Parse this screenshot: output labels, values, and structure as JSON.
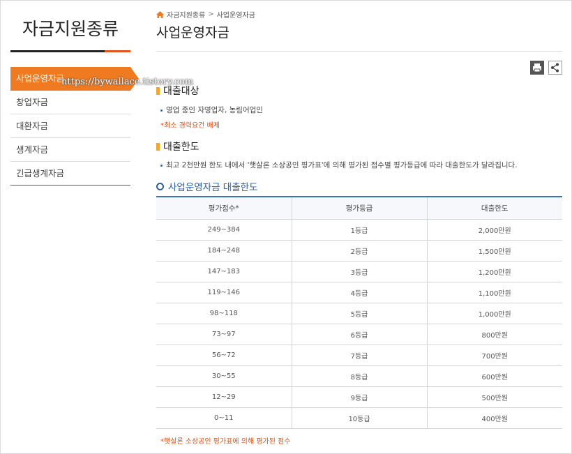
{
  "sidebar": {
    "title": "자금지원종류",
    "items": [
      {
        "label": "사업운영자금"
      },
      {
        "label": "창업자금"
      },
      {
        "label": "대환자금"
      },
      {
        "label": "생계자금"
      },
      {
        "label": "긴급생계자금"
      }
    ],
    "watermark": "https://bywallace.tistory.com"
  },
  "breadcrumb": {
    "items": [
      "자금지원종류",
      "사업운영자금"
    ],
    "separator": ">"
  },
  "page_title": "사업운영자금",
  "toolbar": {
    "print_icon": "print-icon",
    "share_icon": "share-icon"
  },
  "sections": {
    "target": {
      "title": "대출대상",
      "bullet": "영업 중인 자영업자, 농림어업인",
      "note": "*최소 경력요건 배제"
    },
    "limit": {
      "title": "대출한도",
      "bullet": "최고 2천만원 한도 내에서 '햇살론 소상공인 평가표'에 의해 평가된 점수별 평가등급에 따라 대출한도가 달라집니다."
    }
  },
  "table": {
    "caption": "사업운영자금 대출한도",
    "headers": [
      "평가점수*",
      "평가등급",
      "대출한도"
    ],
    "rows": [
      [
        "249~384",
        "1등급",
        "2,000만원"
      ],
      [
        "184~248",
        "2등급",
        "1,500만원"
      ],
      [
        "147~183",
        "3등급",
        "1,200만원"
      ],
      [
        "119~146",
        "4등급",
        "1,100만원"
      ],
      [
        "98~118",
        "5등급",
        "1,000만원"
      ],
      [
        "73~97",
        "6등급",
        "800만원"
      ],
      [
        "56~72",
        "7등급",
        "700만원"
      ],
      [
        "30~55",
        "8등급",
        "600만원"
      ],
      [
        "12~29",
        "9등급",
        "500만원"
      ],
      [
        "0~11",
        "10등급",
        "400만원"
      ]
    ],
    "footnote": "*햇살론 소상공인 평가표에 의해 평가된 점수"
  },
  "colors": {
    "accent": "#f07a1f",
    "link_blue": "#2a5fa8",
    "note": "#e0531a"
  }
}
